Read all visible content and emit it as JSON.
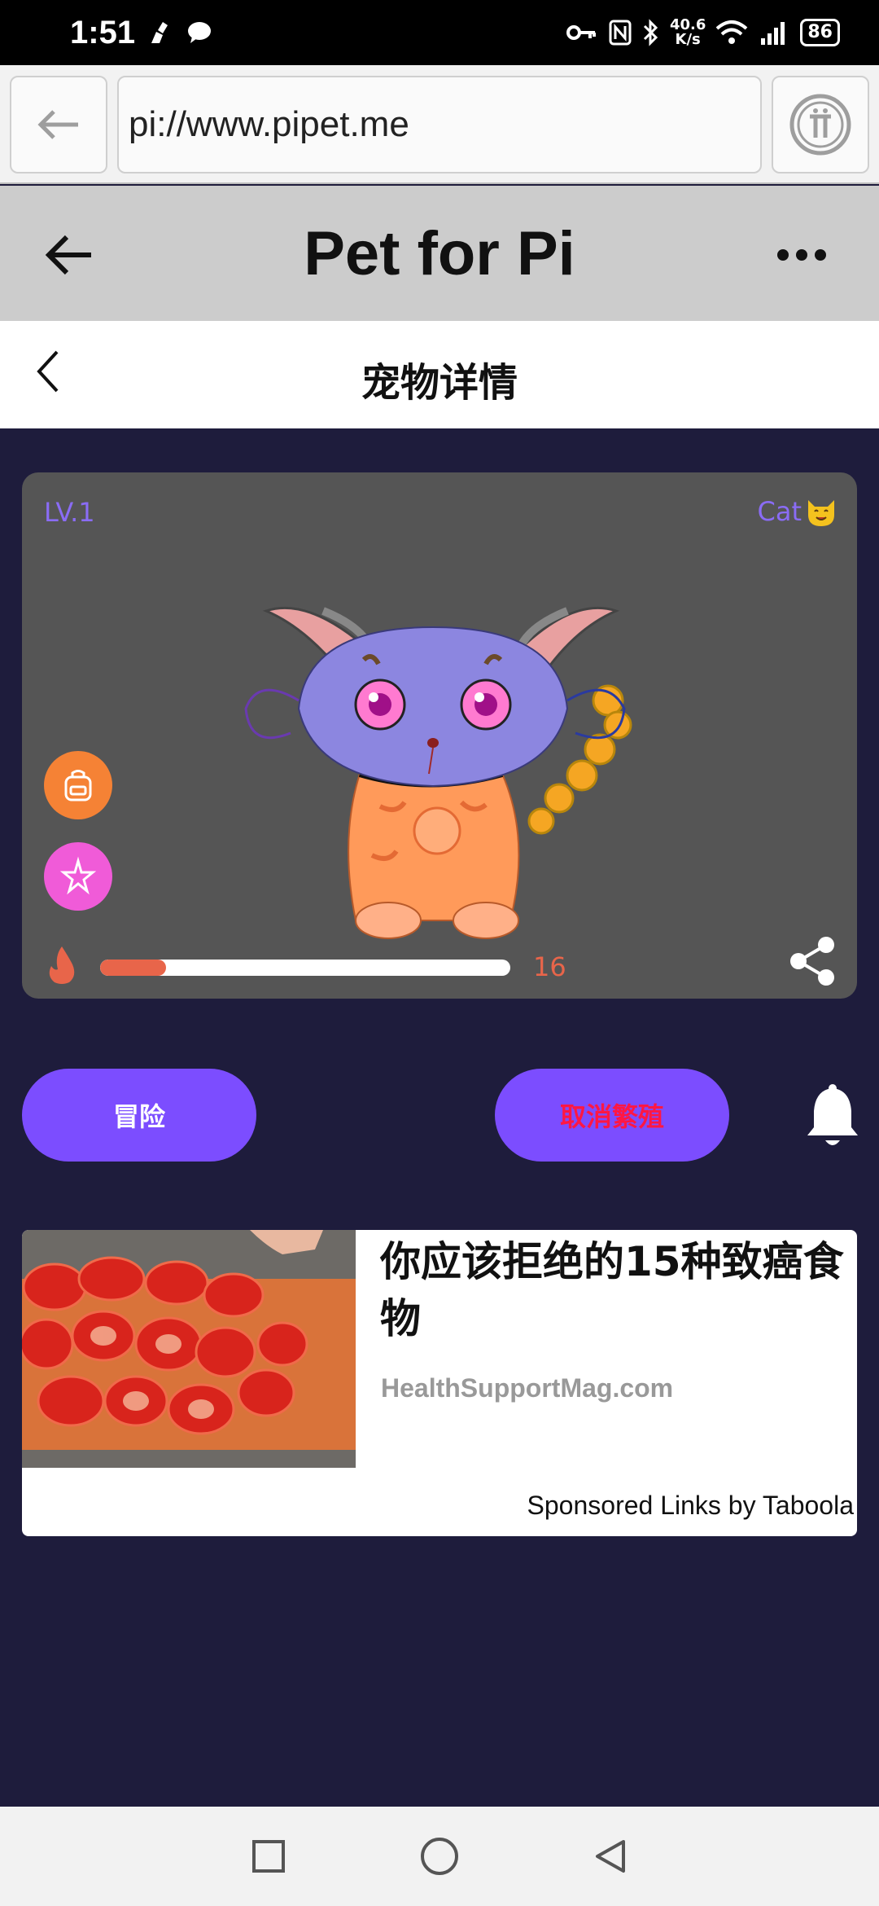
{
  "status_bar": {
    "time": "1:51",
    "net_speed_value": "40.6",
    "net_speed_unit": "K/s",
    "battery": "86"
  },
  "browser": {
    "url": "pi://www.pipet.me"
  },
  "app_header": {
    "title": "Pet for Pi"
  },
  "sub_header": {
    "title": "宠物详情"
  },
  "pet_card": {
    "level": "LV.1",
    "species": "Cat",
    "progress_value": "16",
    "progress_fraction": 0.16
  },
  "actions": {
    "adventure_label": "冒险",
    "cancel_breed_label": "取消繁殖"
  },
  "ad": {
    "title": "你应该拒绝的15种致癌食物",
    "source": "HealthSupportMag.com",
    "sponsor": "Sponsored Links by Taboola"
  },
  "colors": {
    "page_bg": "#1e1c3c",
    "card_bg": "#555555",
    "accent_purple": "#7c4dff",
    "progress": "#e8654a",
    "cancel_text": "#ff1744"
  }
}
